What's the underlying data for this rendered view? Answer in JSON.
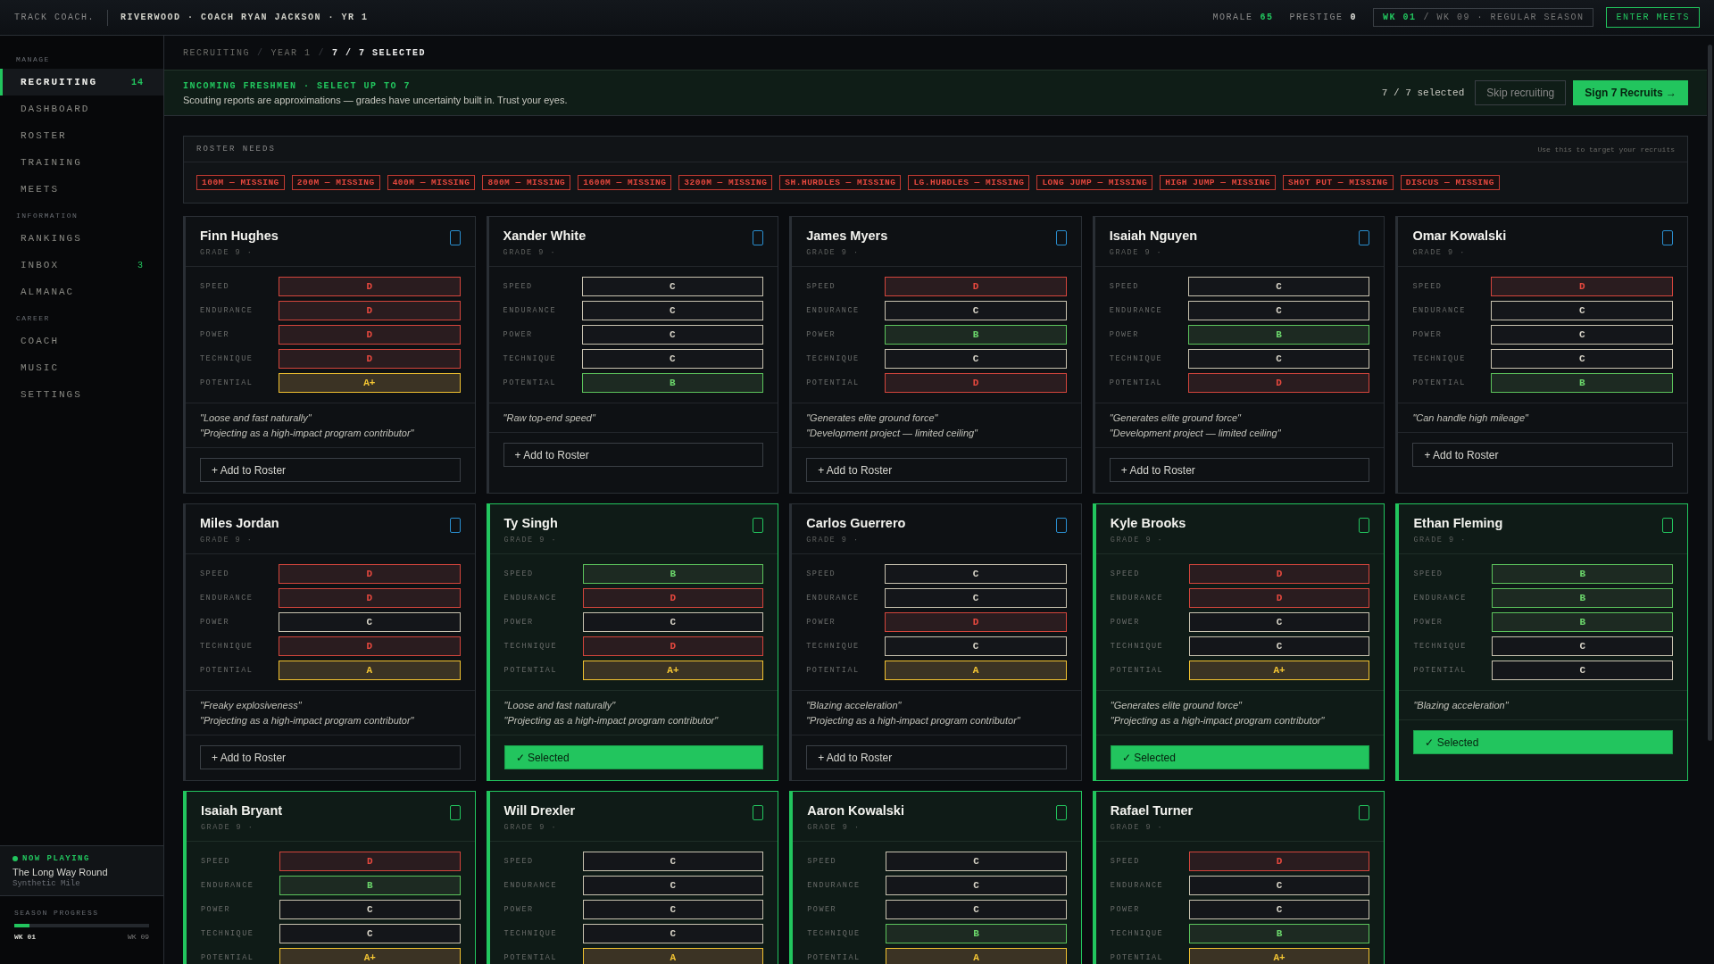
{
  "topbar": {
    "logo": "TRACK COACH.",
    "context": "RIVERWOOD · COACH RYAN JACKSON · YR 1",
    "stats": [
      {
        "label": "MORALE",
        "value": "65",
        "kind": "good"
      },
      {
        "label": "PRESTIGE",
        "value": "0",
        "kind": "plain"
      }
    ],
    "week_current": "WK 01",
    "week_rest": "/ WK 09 · REGULAR SEASON",
    "action": "ENTER MEETS"
  },
  "sidebar": {
    "groups": [
      {
        "title": "MANAGE",
        "items": [
          {
            "label": "RECRUITING",
            "selected": true,
            "badge": "14"
          },
          {
            "label": "DASHBOARD",
            "selected": false
          },
          {
            "label": "ROSTER",
            "selected": false
          },
          {
            "label": "TRAINING",
            "selected": false
          },
          {
            "label": "MEETS",
            "selected": false
          }
        ]
      },
      {
        "title": "INFORMATION",
        "items": [
          {
            "label": "RANKINGS",
            "selected": false
          },
          {
            "label": "INBOX",
            "selected": false,
            "badge": "3"
          },
          {
            "label": "ALMANAC",
            "selected": false
          }
        ]
      },
      {
        "title": "CAREER",
        "items": [
          {
            "label": "COACH",
            "selected": false
          },
          {
            "label": "MUSIC",
            "selected": false
          },
          {
            "label": "SETTINGS",
            "selected": false
          }
        ]
      }
    ],
    "now_playing": {
      "label": "NOW PLAYING",
      "title": "The Long Way Round",
      "artist": "Synthetic Mile"
    },
    "season": {
      "label": "SEASON PROGRESS",
      "level": 0.11,
      "start": "WK 01",
      "end": "WK 09"
    }
  },
  "breadcrumb": [
    {
      "label": "RECRUITING"
    },
    {
      "sep": "/",
      "label": "YEAR 1"
    },
    {
      "sep": "/",
      "label": "7 / 7 SELECTED"
    }
  ],
  "banner": {
    "title": "INCOMING FRESHMEN · SELECT UP TO 7",
    "subtitle": "Scouting reports are approximations — grades have uncertainty built in. Trust your eyes.",
    "count": "7 / 7 selected",
    "skip": "Skip recruiting",
    "sign": "Sign 7 Recruits →"
  },
  "roster_needs": {
    "title": "ROSTER NEEDS",
    "hint": "Use this to target your recruits",
    "tags": [
      "100M — MISSING",
      "200M — MISSING",
      "400M — MISSING",
      "800M — MISSING",
      "1600M — MISSING",
      "3200M — MISSING",
      "SH.HURDLES — MISSING",
      "LG.HURDLES — MISSING",
      "LONG JUMP — MISSING",
      "HIGH JUMP — MISSING",
      "SHOT PUT — MISSING",
      "DISCUS — MISSING"
    ]
  },
  "cards": [
    {
      "name": "Finn Hughes",
      "grade": "GRADE 9 ·",
      "selected": false,
      "ratings": [
        {
          "label": "SPEED",
          "grade": "D",
          "kind": "bad"
        },
        {
          "label": "ENDURANCE",
          "grade": "D",
          "kind": "bad"
        },
        {
          "label": "POWER",
          "grade": "D",
          "kind": "bad"
        },
        {
          "label": "TECHNIQUE",
          "grade": "D",
          "kind": "bad"
        },
        {
          "label": "POTENTIAL",
          "grade": "A+",
          "kind": "top"
        }
      ],
      "quotes": [
        "\"Loose and fast naturally\"",
        "\"Projecting as a high-impact program contributor\""
      ],
      "button": "+ Add to Roster"
    },
    {
      "name": "Xander White",
      "grade": "GRADE 9 ·",
      "selected": false,
      "ratings": [
        {
          "label": "SPEED",
          "grade": "C",
          "kind": "plain"
        },
        {
          "label": "ENDURANCE",
          "grade": "C",
          "kind": "plain"
        },
        {
          "label": "POWER",
          "grade": "C",
          "kind": "plain"
        },
        {
          "label": "TECHNIQUE",
          "grade": "C",
          "kind": "plain"
        },
        {
          "label": "POTENTIAL",
          "grade": "B",
          "kind": "good"
        }
      ],
      "quotes": [
        "\"Raw top-end speed\""
      ],
      "button": "+ Add to Roster"
    },
    {
      "name": "James Myers",
      "grade": "GRADE 9 ·",
      "selected": false,
      "ratings": [
        {
          "label": "SPEED",
          "grade": "D",
          "kind": "bad"
        },
        {
          "label": "ENDURANCE",
          "grade": "C",
          "kind": "plain"
        },
        {
          "label": "POWER",
          "grade": "B",
          "kind": "good"
        },
        {
          "label": "TECHNIQUE",
          "grade": "C",
          "kind": "plain"
        },
        {
          "label": "POTENTIAL",
          "grade": "D",
          "kind": "bad"
        }
      ],
      "quotes": [
        "\"Generates elite ground force\"",
        "\"Development project — limited ceiling\""
      ],
      "button": "+ Add to Roster"
    },
    {
      "name": "Isaiah Nguyen",
      "grade": "GRADE 9 ·",
      "selected": false,
      "ratings": [
        {
          "label": "SPEED",
          "grade": "C",
          "kind": "plain"
        },
        {
          "label": "ENDURANCE",
          "grade": "C",
          "kind": "plain"
        },
        {
          "label": "POWER",
          "grade": "B",
          "kind": "good"
        },
        {
          "label": "TECHNIQUE",
          "grade": "C",
          "kind": "plain"
        },
        {
          "label": "POTENTIAL",
          "grade": "D",
          "kind": "bad"
        }
      ],
      "quotes": [
        "\"Generates elite ground force\"",
        "\"Development project — limited ceiling\""
      ],
      "button": "+ Add to Roster"
    },
    {
      "name": "Omar Kowalski",
      "grade": "GRADE 9 ·",
      "selected": false,
      "ratings": [
        {
          "label": "SPEED",
          "grade": "D",
          "kind": "bad"
        },
        {
          "label": "ENDURANCE",
          "grade": "C",
          "kind": "plain"
        },
        {
          "label": "POWER",
          "grade": "C",
          "kind": "plain"
        },
        {
          "label": "TECHNIQUE",
          "grade": "C",
          "kind": "plain"
        },
        {
          "label": "POTENTIAL",
          "grade": "B",
          "kind": "good"
        }
      ],
      "quotes": [
        "\"Can handle high mileage\""
      ],
      "button": "+ Add to Roster"
    },
    {
      "name": "Miles Jordan",
      "grade": "GRADE 9 ·",
      "selected": false,
      "ratings": [
        {
          "label": "SPEED",
          "grade": "D",
          "kind": "bad"
        },
        {
          "label": "ENDURANCE",
          "grade": "D",
          "kind": "bad"
        },
        {
          "label": "POWER",
          "grade": "C",
          "kind": "plain"
        },
        {
          "label": "TECHNIQUE",
          "grade": "D",
          "kind": "bad"
        },
        {
          "label": "POTENTIAL",
          "grade": "A",
          "kind": "top"
        }
      ],
      "quotes": [
        "\"Freaky explosiveness\"",
        "\"Projecting as a high-impact program contributor\""
      ],
      "button": "+ Add to Roster"
    },
    {
      "name": "Ty Singh",
      "grade": "GRADE 9 ·",
      "selected": true,
      "ratings": [
        {
          "label": "SPEED",
          "grade": "B",
          "kind": "good"
        },
        {
          "label": "ENDURANCE",
          "grade": "D",
          "kind": "bad"
        },
        {
          "label": "POWER",
          "grade": "C",
          "kind": "plain"
        },
        {
          "label": "TECHNIQUE",
          "grade": "D",
          "kind": "bad"
        },
        {
          "label": "POTENTIAL",
          "grade": "A+",
          "kind": "top"
        }
      ],
      "quotes": [
        "\"Loose and fast naturally\"",
        "\"Projecting as a high-impact program contributor\""
      ],
      "button": "✓ Selected"
    },
    {
      "name": "Carlos Guerrero",
      "grade": "GRADE 9 ·",
      "selected": false,
      "ratings": [
        {
          "label": "SPEED",
          "grade": "C",
          "kind": "plain"
        },
        {
          "label": "ENDURANCE",
          "grade": "C",
          "kind": "plain"
        },
        {
          "label": "POWER",
          "grade": "D",
          "kind": "bad"
        },
        {
          "label": "TECHNIQUE",
          "grade": "C",
          "kind": "plain"
        },
        {
          "label": "POTENTIAL",
          "grade": "A",
          "kind": "top"
        }
      ],
      "quotes": [
        "\"Blazing acceleration\"",
        "\"Projecting as a high-impact program contributor\""
      ],
      "button": "+ Add to Roster"
    },
    {
      "name": "Kyle Brooks",
      "grade": "GRADE 9 ·",
      "selected": true,
      "ratings": [
        {
          "label": "SPEED",
          "grade": "D",
          "kind": "bad"
        },
        {
          "label": "ENDURANCE",
          "grade": "D",
          "kind": "bad"
        },
        {
          "label": "POWER",
          "grade": "C",
          "kind": "plain"
        },
        {
          "label": "TECHNIQUE",
          "grade": "C",
          "kind": "plain"
        },
        {
          "label": "POTENTIAL",
          "grade": "A+",
          "kind": "top"
        }
      ],
      "quotes": [
        "\"Generates elite ground force\"",
        "\"Projecting as a high-impact program contributor\""
      ],
      "button": "✓ Selected"
    },
    {
      "name": "Ethan Fleming",
      "grade": "GRADE 9 ·",
      "selected": true,
      "ratings": [
        {
          "label": "SPEED",
          "grade": "B",
          "kind": "good"
        },
        {
          "label": "ENDURANCE",
          "grade": "B",
          "kind": "good"
        },
        {
          "label": "POWER",
          "grade": "B",
          "kind": "good"
        },
        {
          "label": "TECHNIQUE",
          "grade": "C",
          "kind": "plain"
        },
        {
          "label": "POTENTIAL",
          "grade": "C",
          "kind": "plain"
        }
      ],
      "quotes": [
        "\"Blazing acceleration\""
      ],
      "button": "✓ Selected"
    },
    {
      "name": "Isaiah Bryant",
      "grade": "GRADE 9 ·",
      "selected": true,
      "ratings": [
        {
          "label": "SPEED",
          "grade": "D",
          "kind": "bad"
        },
        {
          "label": "ENDURANCE",
          "grade": "B",
          "kind": "good"
        },
        {
          "label": "POWER",
          "grade": "C",
          "kind": "plain"
        },
        {
          "label": "TECHNIQUE",
          "grade": "C",
          "kind": "plain"
        },
        {
          "label": "POTENTIAL",
          "grade": "A+",
          "kind": "top"
        }
      ]
    },
    {
      "name": "Will Drexler",
      "grade": "GRADE 9 ·",
      "selected": true,
      "ratings": [
        {
          "label": "SPEED",
          "grade": "C",
          "kind": "plain"
        },
        {
          "label": "ENDURANCE",
          "grade": "C",
          "kind": "plain"
        },
        {
          "label": "POWER",
          "grade": "C",
          "kind": "plain"
        },
        {
          "label": "TECHNIQUE",
          "grade": "C",
          "kind": "plain"
        },
        {
          "label": "POTENTIAL",
          "grade": "A",
          "kind": "top"
        }
      ]
    },
    {
      "name": "Aaron Kowalski",
      "grade": "GRADE 9 ·",
      "selected": true,
      "ratings": [
        {
          "label": "SPEED",
          "grade": "C",
          "kind": "plain"
        },
        {
          "label": "ENDURANCE",
          "grade": "C",
          "kind": "plain"
        },
        {
          "label": "POWER",
          "grade": "C",
          "kind": "plain"
        },
        {
          "label": "TECHNIQUE",
          "grade": "B",
          "kind": "good"
        },
        {
          "label": "POTENTIAL",
          "grade": "A",
          "kind": "top"
        }
      ]
    },
    {
      "name": "Rafael Turner",
      "grade": "GRADE 9 ·",
      "selected": true,
      "ratings": [
        {
          "label": "SPEED",
          "grade": "D",
          "kind": "bad"
        },
        {
          "label": "ENDURANCE",
          "grade": "C",
          "kind": "plain"
        },
        {
          "label": "POWER",
          "grade": "C",
          "kind": "plain"
        },
        {
          "label": "TECHNIQUE",
          "grade": "B",
          "kind": "good"
        },
        {
          "label": "POTENTIAL",
          "grade": "A+",
          "kind": "top"
        }
      ]
    }
  ]
}
